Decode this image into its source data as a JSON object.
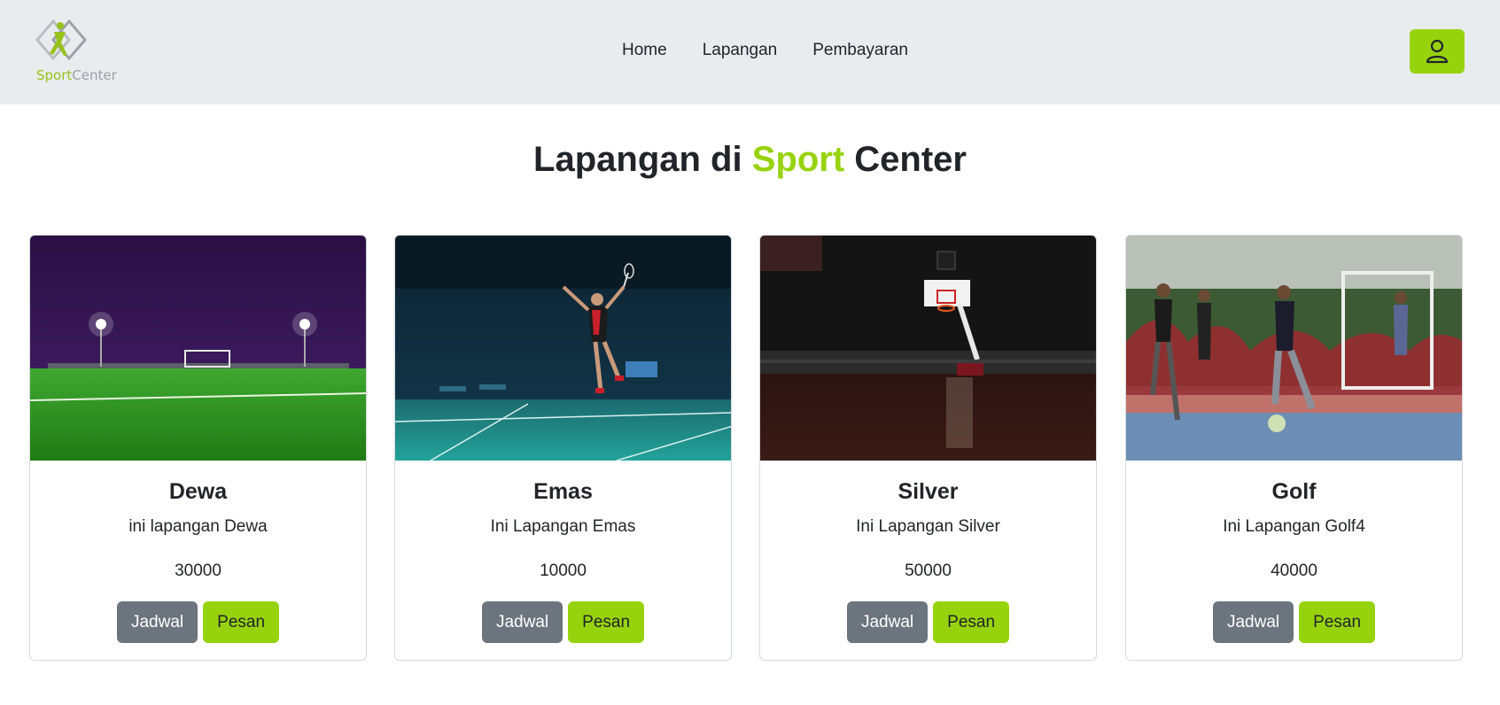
{
  "brand": {
    "part1": "Sport",
    "part2": "Center",
    "logo_icon": "sportcenter-logo-icon"
  },
  "nav": {
    "links": [
      "Home",
      "Lapangan",
      "Pembayaran"
    ],
    "user_icon": "user-icon"
  },
  "colors": {
    "accent": "#97d30c",
    "navbar_bg": "#e9ecef",
    "secondary": "#6c757d"
  },
  "heading": {
    "prefix": "Lapangan di ",
    "accent": "Sport",
    "suffix": " Center"
  },
  "cards": [
    {
      "title": "Dewa",
      "description": "ini lapangan Dewa",
      "price": "30000",
      "schedule_label": "Jadwal",
      "book_label": "Pesan",
      "image": "soccer-field-night-photo"
    },
    {
      "title": "Emas",
      "description": "Ini Lapangan Emas",
      "price": "10000",
      "schedule_label": "Jadwal",
      "book_label": "Pesan",
      "image": "badminton-player-jump-photo"
    },
    {
      "title": "Silver",
      "description": "Ini Lapangan Silver",
      "price": "50000",
      "schedule_label": "Jadwal",
      "book_label": "Pesan",
      "image": "basketball-arena-photo"
    },
    {
      "title": "Golf",
      "description": "Ini Lapangan Golf4",
      "price": "40000",
      "schedule_label": "Jadwal",
      "book_label": "Pesan",
      "image": "futsal-players-photo"
    }
  ]
}
